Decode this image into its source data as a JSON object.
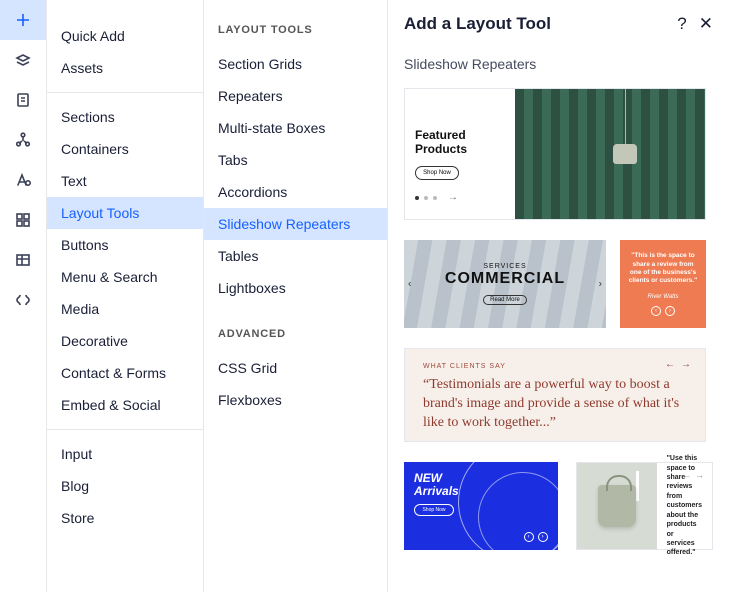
{
  "iconbar": [
    {
      "name": "plus-icon",
      "active": true
    },
    {
      "name": "layers-icon"
    },
    {
      "name": "page-icon"
    },
    {
      "name": "network-icon"
    },
    {
      "name": "typography-icon"
    },
    {
      "name": "grid-icon"
    },
    {
      "name": "table-icon"
    },
    {
      "name": "codeblock-icon"
    }
  ],
  "col1": {
    "groups": [
      [
        {
          "label": "Quick Add"
        },
        {
          "label": "Assets"
        }
      ],
      [
        {
          "label": "Sections"
        },
        {
          "label": "Containers"
        },
        {
          "label": "Text"
        },
        {
          "label": "Layout Tools",
          "selected": true
        },
        {
          "label": "Buttons"
        },
        {
          "label": "Menu & Search"
        },
        {
          "label": "Media"
        },
        {
          "label": "Decorative"
        },
        {
          "label": "Contact & Forms"
        },
        {
          "label": "Embed & Social"
        }
      ],
      [
        {
          "label": "Input"
        },
        {
          "label": "Blog"
        },
        {
          "label": "Store"
        }
      ]
    ]
  },
  "col2": {
    "sections": [
      {
        "heading": "LAYOUT TOOLS",
        "items": [
          {
            "label": "Section Grids"
          },
          {
            "label": "Repeaters"
          },
          {
            "label": "Multi-state Boxes"
          },
          {
            "label": "Tabs"
          },
          {
            "label": "Accordions"
          },
          {
            "label": "Slideshow Repeaters",
            "selected": true
          },
          {
            "label": "Tables"
          },
          {
            "label": "Lightboxes"
          }
        ]
      },
      {
        "heading": "ADVANCED",
        "items": [
          {
            "label": "CSS Grid"
          },
          {
            "label": "Flexboxes"
          }
        ]
      }
    ]
  },
  "panel": {
    "title": "Add a Layout Tool",
    "subtitle": "Slideshow Repeaters",
    "ex1": {
      "title1": "Featured",
      "title2": "Products",
      "btn": "Shop Now"
    },
    "ex2": {
      "services": "SERVICES",
      "big": "COMMERCIAL",
      "readmore": "Read More",
      "quote": "\"This is the space to share a review from one of the business's clients or customers.\"",
      "author": "River Watts"
    },
    "ex3": {
      "label": "WHAT CLIENTS SAY",
      "quote": "“Testimonials are a powerful way to boost a brand's image and provide a sense of what it's like to work together...”"
    },
    "ex4": {
      "l1": "NEW",
      "l2": "Arrivals",
      "btn": "Shop Now"
    },
    "ex5": {
      "text": "\"Use this space to share reviews from customers about the products or services offered.\""
    }
  }
}
